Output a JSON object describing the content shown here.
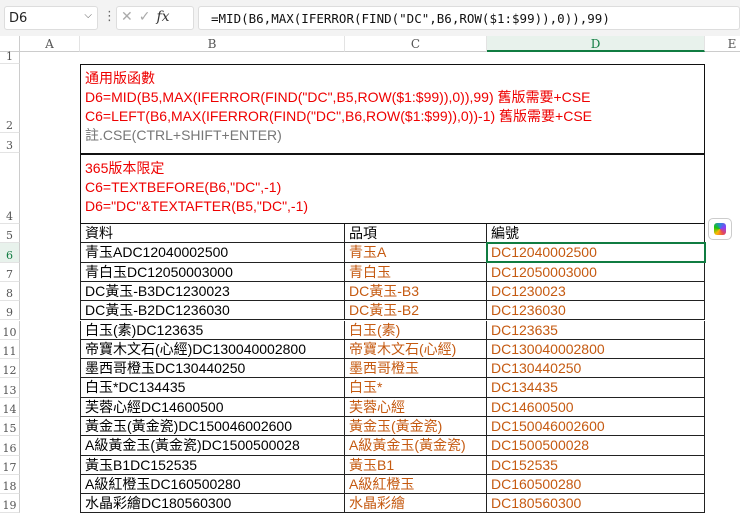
{
  "formula_bar": {
    "name_box": "D6",
    "fx": "fx",
    "formula": "=MID(B6,MAX(IFERROR(FIND(\"DC\",B6,ROW($1:$99)),0)),99)"
  },
  "columns": [
    "A",
    "B",
    "C",
    "D",
    "E"
  ],
  "rows": [
    "1",
    "2",
    "3",
    "4",
    "5",
    "6",
    "7",
    "8",
    "9",
    "10",
    "11",
    "12",
    "13",
    "14",
    "15",
    "16",
    "17",
    "18",
    "19"
  ],
  "notes": {
    "box1": {
      "title": "通用版函數",
      "line1": "D6=MID(B5,MAX(IFERROR(FIND(\"DC\",B5,ROW($1:$99)),0)),99) 舊版需要+CSE",
      "line2": "C6=LEFT(B6,MAX(IFERROR(FIND(\"DC\",B6,ROW($1:$99)),0))-1) 舊版需要+CSE",
      "note": "註.CSE(CTRL+SHIFT+ENTER)"
    },
    "box2": {
      "title": "365版本限定",
      "line1": "C6=TEXTBEFORE(B6,\"DC\",-1)",
      "line2": "D6=\"DC\"&TEXTAFTER(B5,\"DC\",-1)"
    }
  },
  "table": {
    "headers": [
      "資料",
      "品項",
      "編號"
    ],
    "rows": [
      [
        "青玉ADC12040002500",
        "青玉A",
        "DC12040002500"
      ],
      [
        "青白玉DC12050003000",
        "青白玉",
        "DC12050003000"
      ],
      [
        "DC黃玉-B3DC1230023",
        "DC黃玉-B3",
        "DC1230023"
      ],
      [
        "DC黃玉-B2DC1236030",
        "DC黃玉-B2",
        "DC1236030"
      ],
      [
        "白玉(素)DC123635",
        "白玉(素)",
        "DC123635"
      ],
      [
        "帝寶木文石(心經)DC130040002800",
        "帝寶木文石(心經)",
        "DC130040002800"
      ],
      [
        "墨西哥橙玉DC130440250",
        "墨西哥橙玉",
        "DC130440250"
      ],
      [
        "白玉*DC134435",
        "白玉*",
        "DC134435"
      ],
      [
        "芙蓉心經DC14600500",
        "芙蓉心經",
        "DC14600500"
      ],
      [
        "黃金玉(黃金瓷)DC150046002600",
        "黃金玉(黃金瓷)",
        "DC150046002600"
      ],
      [
        "A級黃金玉(黃金瓷)DC1500500028",
        "A級黃金玉(黃金瓷)",
        "DC1500500028"
      ],
      [
        "黃玉B1DC152535",
        "黃玉B1",
        "DC152535"
      ],
      [
        "A級紅橙玉DC160500280",
        "A級紅橙玉",
        "DC160500280"
      ],
      [
        "水晶彩繪DC180560300",
        "水晶彩繪",
        "DC180560300"
      ]
    ]
  },
  "colors": {
    "accent": "#107c41",
    "red": "#ee0000",
    "orange": "#c55a11"
  }
}
